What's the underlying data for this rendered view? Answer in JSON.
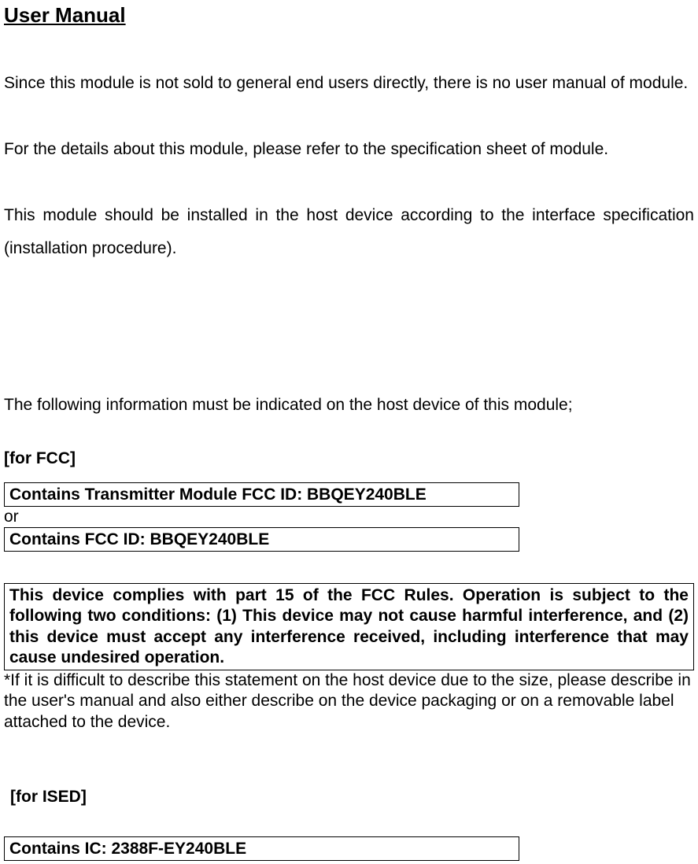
{
  "title": "User Manual",
  "paragraphs": {
    "p1": "Since this module is not sold to general end users directly, there is no user manual of module.",
    "p2": "For the details about this module, please refer to the specification sheet of module.",
    "p3": "This module should be installed in the host device according to the interface specification (installation procedure).",
    "p4": "The following information must be indicated on the host device of this module;"
  },
  "fcc": {
    "label": "[for FCC]",
    "box1": "Contains Transmitter Module FCC ID: BBQEY240BLE",
    "or": "or",
    "box2": "Contains FCC ID: BBQEY240BLE",
    "compliance": "This device complies with part 15 of the FCC Rules. Operation is subject to the following two conditions: (1) This device may not cause harmful interference, and (2) this device must accept any interference received, including interference that may cause undesired operation.",
    "footnote": "*If it is difficult to describe this statement on the host device due to the size, please describe in the user's manual and also either describe on the device packaging or on a removable label attached to the device."
  },
  "ised": {
    "label": "[for ISED]",
    "box1": "Contains IC: 2388F-EY240BLE"
  }
}
